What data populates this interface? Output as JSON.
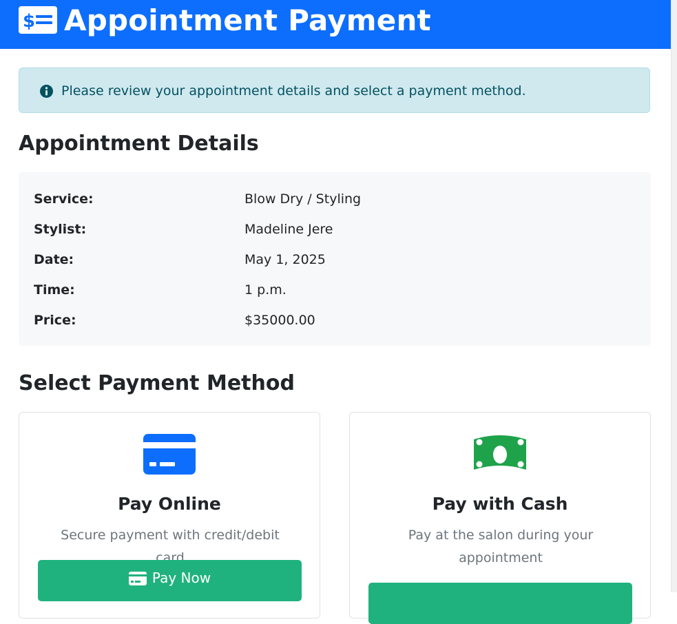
{
  "header": {
    "title": "Appointment Payment",
    "icon": "money-check-icon",
    "color": "#0d6efd"
  },
  "alert": {
    "icon": "info-circle-icon",
    "text": "Please review your appointment details and select a payment method."
  },
  "details": {
    "title": "Appointment Details",
    "rows": [
      {
        "label": "Service:",
        "value": "Blow Dry / Styling"
      },
      {
        "label": "Stylist:",
        "value": "Madeline Jere"
      },
      {
        "label": "Date:",
        "value": "May 1, 2025"
      },
      {
        "label": "Time:",
        "value": "1 p.m."
      },
      {
        "label": "Price:",
        "value": "$35000.00"
      }
    ]
  },
  "payment": {
    "title": "Select Payment Method",
    "online": {
      "icon": "credit-card-icon",
      "title": "Pay Online",
      "description": "Secure payment with credit/debit card",
      "button_label": "Pay Now",
      "button_icon": "credit-card-icon",
      "icon_color": "#0d6efd"
    },
    "cash": {
      "icon": "money-bill-icon",
      "title": "Pay with Cash",
      "description": "Pay at the salon during your appointment",
      "icon_color": "#1ea34a"
    },
    "button_color": "#20b27e"
  }
}
